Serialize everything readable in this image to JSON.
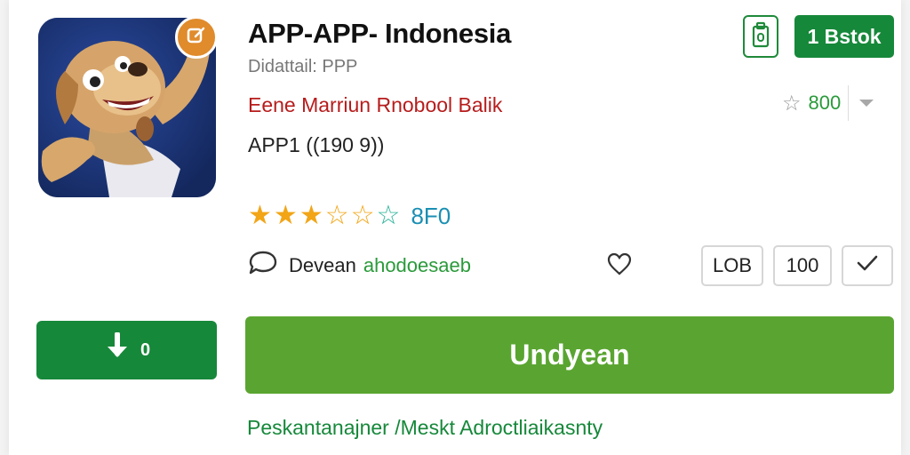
{
  "app": {
    "title": "APP-APP- Indonesia",
    "subtitle": "Didattail: PPP",
    "developer": "Eene Marriun Rnobool Balik",
    "version": "APP1 ((190 9))"
  },
  "header_actions": {
    "top_action_label": "1 Bstok",
    "rating_chip_value": "800"
  },
  "rating": {
    "value": 2.5,
    "max": 5,
    "label": "8F0"
  },
  "meta": {
    "label": "Devean",
    "value": "ahodoesaeb"
  },
  "boxes": {
    "first": "LOB",
    "second": "100"
  },
  "buttons": {
    "small_download_count": "0",
    "install_label": "Undyean"
  },
  "footer": {
    "link_text": "Peskantanajner /Meskt Adroctliaikasnty"
  },
  "colors": {
    "primary_green": "#16883a",
    "install_green": "#5aa531",
    "developer_red": "#b71c1c",
    "star_orange": "#f2a516",
    "rating_blue": "#1a8fb3"
  },
  "icons": {
    "save": "bookmark-clip-icon",
    "star": "star-icon",
    "chevron": "chevron-down-icon",
    "comment": "chat-bubble-icon",
    "heart": "heart-icon",
    "check": "check-icon",
    "download": "download-arrow-icon",
    "edit": "edit-icon"
  }
}
